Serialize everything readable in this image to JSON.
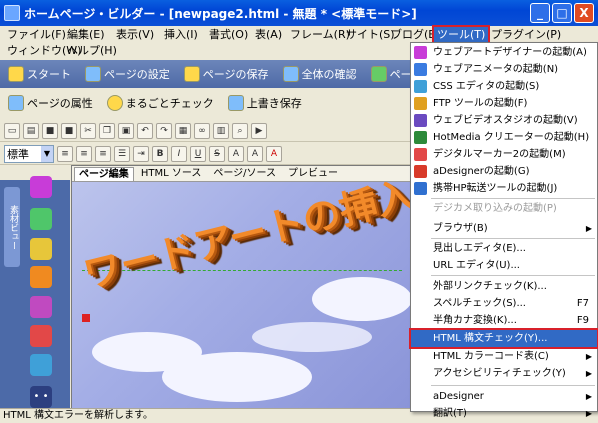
{
  "window": {
    "title": "ホームページ・ビルダー - [newpage2.html - 無題 * <標準モード>]",
    "minimize": "_",
    "maximize": "□",
    "close": "X"
  },
  "menubar": {
    "row1": [
      "ファイル(F)",
      "編集(E)",
      "表示(V)",
      "挿入(I)",
      "書式(O)",
      "表(A)",
      "フレーム(R)",
      "サイト(S)",
      "ブログ(B)",
      "ツール(T)",
      "プラグイン(P)"
    ],
    "row2": [
      "ウィンドウ(W)",
      "ヘルプ(H)"
    ]
  },
  "toolbands": {
    "top": [
      "スタート",
      "ページの設定",
      "ページの保存",
      "全体の確認",
      "ページの公開"
    ],
    "second": [
      "ページの属性",
      "まるごとチェック",
      "上書き保存"
    ]
  },
  "format": {
    "style_value": "標準"
  },
  "editor": {
    "tabs": [
      "ページ編集",
      "HTML ソース",
      "ページ/ソース",
      "プレビュー"
    ],
    "wordart": "ワードアートの挿入"
  },
  "sidepanel": {
    "tab_label": "素材ビュー"
  },
  "status": {
    "text": "HTML 構文エラーを解析します。"
  },
  "dropdown": {
    "items": [
      {
        "label": "ウェブアートデザイナーの起動(A)",
        "shortcut": "",
        "disabled": false,
        "submenu": false
      },
      {
        "label": "ウェブアニメータの起動(N)",
        "shortcut": "",
        "disabled": false,
        "submenu": false
      },
      {
        "label": "CSS エディタの起動(S)",
        "shortcut": "",
        "disabled": false,
        "submenu": false
      },
      {
        "label": "FTP ツールの起動(F)",
        "shortcut": "",
        "disabled": false,
        "submenu": false
      },
      {
        "label": "ウェブビデオスタジオの起動(V)",
        "shortcut": "",
        "disabled": false,
        "submenu": false
      },
      {
        "label": "HotMedia クリエーターの起動(H)",
        "shortcut": "",
        "disabled": false,
        "submenu": false
      },
      {
        "label": "デジタルマーカー2の起動(M)",
        "shortcut": "",
        "disabled": false,
        "submenu": false
      },
      {
        "label": "aDesignerの起動(G)",
        "shortcut": "",
        "disabled": false,
        "submenu": false
      },
      {
        "label": "携帯HP転送ツールの起動(J)",
        "shortcut": "",
        "disabled": false,
        "submenu": false
      },
      {
        "label": "デジカメ取り込みの起動(P)",
        "shortcut": "",
        "disabled": true,
        "submenu": false
      },
      {
        "label": "ブラウザ(B)",
        "shortcut": "",
        "disabled": false,
        "submenu": true
      },
      {
        "label": "見出しエディタ(E)...",
        "shortcut": "",
        "disabled": false,
        "submenu": false
      },
      {
        "label": "URL エディタ(U)...",
        "shortcut": "",
        "disabled": false,
        "submenu": false
      },
      {
        "label": "外部リンクチェック(K)...",
        "shortcut": "",
        "disabled": false,
        "submenu": false
      },
      {
        "label": "スペルチェック(S)...",
        "shortcut": "F7",
        "disabled": false,
        "submenu": false
      },
      {
        "label": "半角カナ変換(K)...",
        "shortcut": "F9",
        "disabled": false,
        "submenu": false
      },
      {
        "label": "HTML 構文チェック(Y)...",
        "shortcut": "",
        "disabled": false,
        "submenu": false,
        "highlighted": true
      },
      {
        "label": "HTML カラーコード表(C)",
        "shortcut": "",
        "disabled": false,
        "submenu": true
      },
      {
        "label": "アクセシビリティチェック(Y)",
        "shortcut": "",
        "disabled": false,
        "submenu": true
      },
      {
        "label": "aDesigner",
        "shortcut": "",
        "disabled": false,
        "submenu": true
      },
      {
        "label": "翻訳(T)",
        "shortcut": "",
        "disabled": false,
        "submenu": true
      }
    ]
  },
  "colors": {
    "accent": "#316ac5",
    "highlight_outline": "#d8202a",
    "titlebar": "#0046d5"
  }
}
